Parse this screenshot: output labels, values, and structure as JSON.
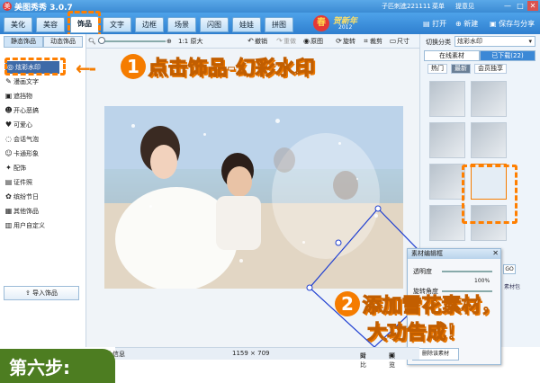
{
  "titlebar": {
    "app_title": "美图秀秀 3.0.7",
    "logo_glyph": "美",
    "user": "子匹刺進221111",
    "menu": "菜单",
    "feedback": "提意见",
    "min": "—",
    "max": "□",
    "close": "✕"
  },
  "tabs": [
    "美化",
    "美容",
    "饰品",
    "文字",
    "边框",
    "场景",
    "闪图",
    "娃娃",
    "拼图"
  ],
  "active_tab": "饰品",
  "banner": {
    "glyph": "春",
    "text": "贺新年",
    "year": "2012"
  },
  "top_buttons": {
    "open": "打开",
    "new": "新建",
    "save_share": "保存与分享"
  },
  "toolbar": {
    "original_size": "1:1 原大",
    "undo": "撤销",
    "redo": "重做",
    "original": "原图",
    "rotate": "旋转",
    "crop": "裁剪",
    "size": "尺寸"
  },
  "left_panel": {
    "subtabs": [
      "静态饰品",
      "动态饰品"
    ],
    "items": [
      {
        "label": "炫彩水印",
        "icon": "◎",
        "selected": true
      },
      {
        "label": "漫画文字",
        "icon": "✎"
      },
      {
        "label": "遮挡物",
        "icon": "▣"
      },
      {
        "label": "开心恶搞",
        "icon": "☻"
      },
      {
        "label": "可爱心",
        "icon": "♥"
      },
      {
        "label": "会话气泡",
        "icon": "◌"
      },
      {
        "label": "卡通形象",
        "icon": "☺"
      },
      {
        "label": "配饰",
        "icon": "✦"
      },
      {
        "label": "证件照",
        "icon": "▤"
      },
      {
        "label": "缤纷节日",
        "icon": "✿"
      },
      {
        "label": "其他饰品",
        "icon": "▦"
      },
      {
        "label": "用户自定义",
        "icon": "▥"
      }
    ],
    "import_button": "导入饰品"
  },
  "annotations": {
    "arrow": "←-",
    "step1_num": "1",
    "step1_text": "点击饰品-幻彩水印",
    "step2_num": "2",
    "step2_line1": "添加雪花素材，",
    "step2_line2": "大功告成！",
    "step_label": "第六步:"
  },
  "right_panel": {
    "switch_label": "切换分类",
    "category": "炫彩水印",
    "tab_online": "在线素材",
    "tab_downloaded": "已下载(22)",
    "subtabs": [
      "热门",
      "最新",
      "会员独享"
    ],
    "go": "GO",
    "material_pack": "素材包"
  },
  "editor": {
    "title": "素材编辑框",
    "close": "✕",
    "opacity_label": "透明度",
    "opacity_value": "100%",
    "rotate_label": "旋转角度",
    "button": "删除该素材"
  },
  "statusbar": {
    "info": "片信息",
    "dimensions": "1159 × 709",
    "compare": "对比",
    "preview": "预览"
  }
}
